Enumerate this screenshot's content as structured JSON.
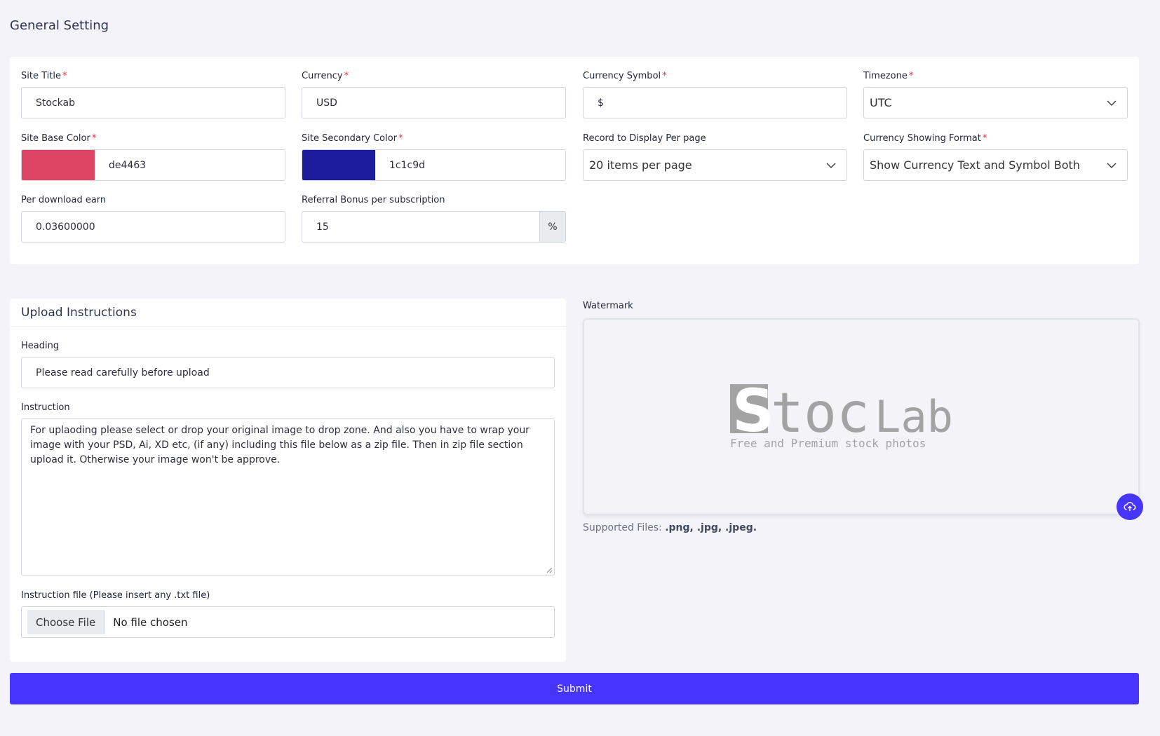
{
  "page": {
    "title": "General Setting"
  },
  "general": {
    "site_title": {
      "label": "Site Title",
      "value": "Stockab"
    },
    "currency": {
      "label": "Currency",
      "value": "USD"
    },
    "currency_symbol": {
      "label": "Currency Symbol",
      "value": "$"
    },
    "timezone": {
      "label": "Timezone",
      "value": "UTC"
    },
    "base_color": {
      "label": "Site Base Color",
      "value": "de4463",
      "hex": "#de4463"
    },
    "secondary_color": {
      "label": "Site Secondary Color",
      "value": "1c1c9d",
      "hex": "#1c1c9d"
    },
    "records_per_page": {
      "label": "Record to Display Per page",
      "value": "20 items per page"
    },
    "currency_format": {
      "label": "Currency Showing Format",
      "value": "Show Currency Text and Symbol Both"
    },
    "per_download_earn": {
      "label": "Per download earn",
      "value": "0.03600000"
    },
    "referral_bonus": {
      "label": "Referral Bonus per subscription",
      "value": "15",
      "suffix": "%"
    },
    "required_mark": "*"
  },
  "upload": {
    "title": "Upload Instructions",
    "heading_label": "Heading",
    "heading_value": "Please read carefully before upload",
    "instruction_label": "Instruction",
    "instruction_value": "For uplaoding please select or drop your original image to drop zone. And also you have to wrap your image with your PSD, Ai, XD etc, (if any) including this file below as a zip file. Then in zip file section upload it. Otherwise your image won't be approve.",
    "file_label": "Instruction file (Please insert any .txt file)",
    "choose_file": "Choose File",
    "no_file": "No file chosen"
  },
  "watermark": {
    "label": "Watermark",
    "logo_s": "S",
    "logo_toc": "toc",
    "logo_lab": "Lab",
    "logo_tagline": "Free and Premium stock photos",
    "supported_prefix": "Supported Files: ",
    "supported_types": ".png, .jpg, .jpeg."
  },
  "submit_label": "Submit",
  "colors": {
    "accent": "#4634ff",
    "logo_gray": "#a3a3a3"
  }
}
